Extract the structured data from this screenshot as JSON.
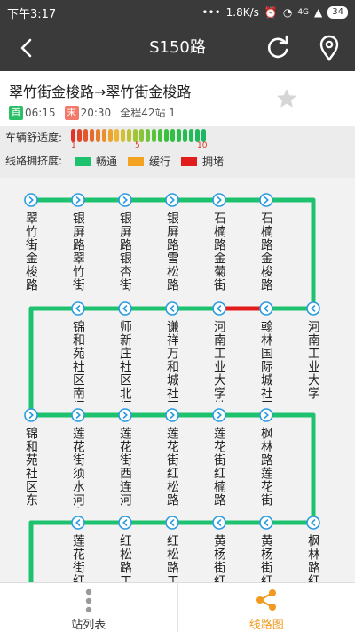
{
  "status": {
    "time": "下午3:17",
    "net": "1.8K/s",
    "signal": "4G",
    "battery": "34"
  },
  "nav": {
    "title": "S150路"
  },
  "route": {
    "name": "翠竹街金梭路→翠竹街金梭路",
    "first_tag": "首",
    "first_time": "06:15",
    "last_tag": "末",
    "last_time": "20:30",
    "station_count": "全程42站 1"
  },
  "comfort": {
    "label": "车辆舒适度:",
    "scale_marks": [
      "1",
      "5",
      "10"
    ]
  },
  "crowd": {
    "label": "线路拥挤度:",
    "legend": [
      {
        "name": "畅通",
        "color": "#1ec16e"
      },
      {
        "name": "缓行",
        "color": "#f3a321"
      },
      {
        "name": "拥堵",
        "color": "#e21b1b"
      }
    ]
  },
  "stations": [
    "翠竹街金梭路",
    "银屏路翠竹街",
    "银屏路银杏街",
    "银屏路雪松路",
    "石楠路金菊街",
    "石楠路金梭路",
    "河南工业大学",
    "翰林国际城社区北门",
    "河南工业大学地铁站",
    "谦祥万和城社区南门",
    "师新庄社区北门",
    "锦和苑社区南门",
    "锦和苑社区东门",
    "莲花街须水河东路",
    "莲花街西连河",
    "莲花街红松路",
    "莲花街红楠路",
    "枫林路莲花街",
    "枫林路红",
    "黄杨街红",
    "黄杨街红",
    "红松路工",
    "红松路工",
    "莲花街红"
  ],
  "tabs": {
    "list": "站列表",
    "graph": "线路图"
  },
  "colors": {
    "smooth": "#1ec16e",
    "jam": "#e21b1b",
    "active_tab": "#f09a1e",
    "node": "#2b9be0"
  }
}
